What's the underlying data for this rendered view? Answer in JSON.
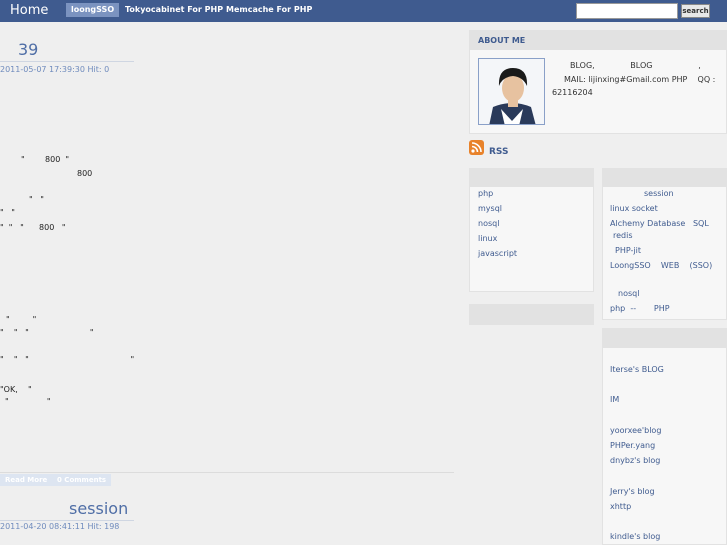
{
  "topbar": {
    "home": "Home",
    "nav": [
      "loongSSO",
      "Tokyocabinet For PHP",
      "Memcache For PHP"
    ],
    "search_value": "",
    "search_button": "search"
  },
  "post1": {
    "title": "39",
    "meta": "2011-05-07 17:39:30  Hit: 0",
    "lines": [
      "\"        800  \"",
      "800",
      "\"   \"",
      "\"   \"",
      "\"  \"   \"      800   \"",
      "\"         \"",
      "\"    \"   \"                        \"",
      "\"    \"   \"                                        \"",
      "\"OK,    \"",
      "\"               \""
    ],
    "read_more": "Read More",
    "comments": "0 Comments"
  },
  "post2": {
    "title": "session",
    "meta": "2011-04-20 08:41:11  Hit: 198"
  },
  "sidebar": {
    "about_title": "ABOUT ME",
    "about_lines": [
      "BLOG,              BLOG                  ,",
      "MAIL: lijinxing#Gmail.com PHP    QQ :",
      "62116204"
    ],
    "rss": "RSS",
    "categories": [
      "php",
      "mysql",
      "nosql",
      "linux",
      "javascript"
    ],
    "recent": [
      "session",
      "linux socket",
      "Alchemy Database   SQL",
      "redis",
      "PHP-jit",
      "LoongSSO    WEB    (SSO)",
      "nosql",
      "php  --       PHP"
    ],
    "links": [
      "Iterse's BLOG",
      "IM",
      "yoorxee'blog",
      "PHPer.yang",
      "dnybz's blog",
      "Jerry's blog",
      "xhttp",
      "kindle's blog"
    ]
  }
}
